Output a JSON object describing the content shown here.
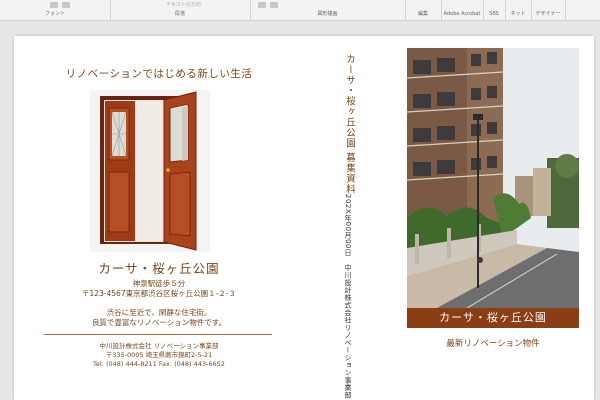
{
  "ribbon": {
    "groups": [
      "フォント",
      "段落",
      "図形描画",
      "編集",
      "Adobe Acrobat",
      "SBS",
      "ネット",
      "デザイナー"
    ],
    "faded": [
      "テキストの方向",
      "文字の配置",
      "SmartArt に変換"
    ]
  },
  "left": {
    "tagline": "リノベーションではじめる新しい生活",
    "title": "カーサ・桜ヶ丘公園",
    "station": "神泉駅徒歩５分",
    "address": "〒123-4567東京都渋谷区桜ヶ丘公園１-２-３",
    "desc_line1": "渋谷に至近で、閑静な住宅街。",
    "desc_line2": "良質で豊富なリノベーション物件です。",
    "company_name": "中川設計株式会社 リノベーション事業部",
    "company_address": "〒335-0005 埼玉県蕨市錦町2-5-21",
    "company_contact": "Tel: (048) 444-8211 Fax: (048) 443-6652"
  },
  "spine": {
    "title": "カーサ・桜ヶ丘公園 募集資料",
    "meta": "202X年00月00日　中川設計株式会社リノベーション事業部"
  },
  "right": {
    "banner": "カーサ・桜ヶ丘公園",
    "subtitle": "最新リノベーション物件"
  },
  "colors": {
    "accent": "#8b3e14",
    "text": "#7a4518"
  }
}
